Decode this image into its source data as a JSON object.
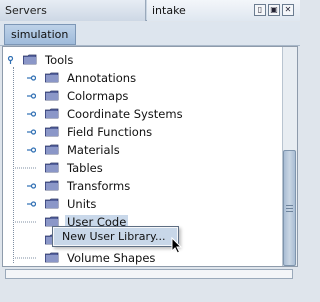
{
  "tabs": {
    "servers": "Servers",
    "intake": "intake"
  },
  "window_buttons": [
    "restore-icon",
    "maximize-icon",
    "close-icon"
  ],
  "subtab": "simulation",
  "tree": {
    "root": "Tools",
    "items": [
      {
        "label": "Annotations",
        "expandable": true
      },
      {
        "label": "Colormaps",
        "expandable": true
      },
      {
        "label": "Coordinate Systems",
        "expandable": true
      },
      {
        "label": "Field Functions",
        "expandable": true
      },
      {
        "label": "Materials",
        "expandable": true
      },
      {
        "label": "Tables",
        "expandable": false
      },
      {
        "label": "Transforms",
        "expandable": true
      },
      {
        "label": "Units",
        "expandable": true
      },
      {
        "label": "User Code",
        "expandable": false,
        "selected": true
      },
      {
        "label": "",
        "expandable": false
      },
      {
        "label": "Volume Shapes",
        "expandable": false
      }
    ]
  },
  "context_menu": {
    "items": [
      "New User Library..."
    ]
  },
  "colors": {
    "selection": "#c9d8ea",
    "menu_highlight": "#c8d7e8",
    "folder": "#4f5d9c",
    "handle": "#2f6fb3"
  }
}
